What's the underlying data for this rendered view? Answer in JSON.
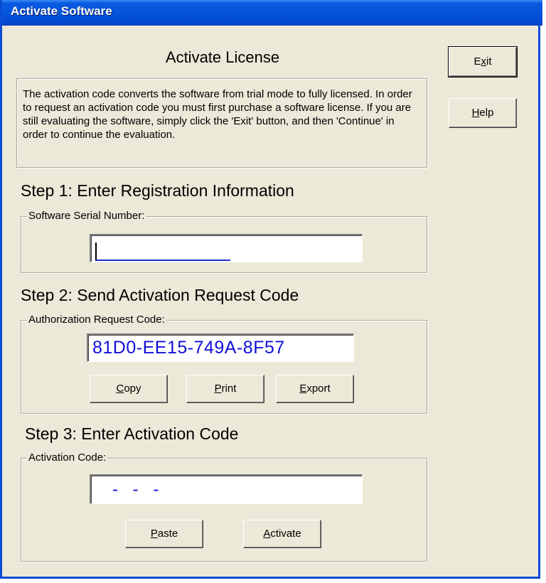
{
  "window": {
    "title": "Activate Software"
  },
  "header": {
    "title": "Activate License",
    "description": "The activation code converts the software from trial mode to fully licensed.  In order to request an activation code you must first purchase a software license.  If you are still evaluating the software, simply click the 'Exit' button, and then 'Continue' in order to continue the evaluation."
  },
  "side_buttons": {
    "exit": {
      "pre": "E",
      "key": "x",
      "post": "it"
    },
    "help": {
      "pre": "",
      "key": "H",
      "post": "elp"
    }
  },
  "step1": {
    "title": "Step 1: Enter Registration Information",
    "group_label": "Software Serial Number:",
    "serial_value": ""
  },
  "step2": {
    "title": "Step 2: Send Activation Request Code",
    "group_label": "Authorization Request Code:",
    "request_code": "81D0-EE15-749A-8F57",
    "copy": {
      "pre": "",
      "key": "C",
      "post": "opy"
    },
    "print": {
      "pre": "",
      "key": "P",
      "post": "rint"
    },
    "export": {
      "pre": "",
      "key": "E",
      "post": "xport"
    }
  },
  "step3": {
    "title": "Step 3: Enter Activation Code",
    "group_label": "Activation Code:",
    "activation_placeholder": "- - -",
    "paste": {
      "pre": "",
      "key": "P",
      "post": "aste"
    },
    "activate": {
      "pre": "",
      "key": "A",
      "post": "ctivate"
    }
  },
  "colors": {
    "titlebar": "#0454dc",
    "dialog_bg": "#ece9d8",
    "code_text": "#1010d8"
  }
}
